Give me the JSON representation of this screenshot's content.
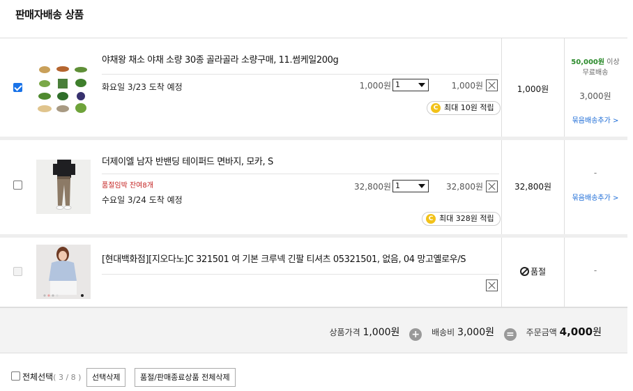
{
  "section_title": "판매자배송 상품",
  "items": [
    {
      "checked": true,
      "name": "야채왕 채소 야채 소량 30종 골라골라 소량구매, 11.썸케일200g",
      "arrival": "화요일 3/23 도착 예정",
      "unit_price": "1,000원",
      "qty": "1",
      "line_price": "1,000원",
      "points": "최대 10원 적립",
      "coin_label": "C",
      "subtotal": "1,000원",
      "shipping": {
        "free_amount": "50,000원",
        "free_suffix": " 이상",
        "free_text": "무료배송",
        "fee": "3,000원",
        "bundle": "묶음배송추가 >"
      }
    },
    {
      "checked": false,
      "name": "더제이엘 남자 반밴딩 테이퍼드 면바지, 모카, S",
      "warning": "품절임박 잔여8개",
      "arrival": "수요일 3/24 도착 예정",
      "unit_price": "32,800원",
      "qty": "1",
      "line_price": "32,800원",
      "points": "최대 328원 적립",
      "coin_label": "C",
      "subtotal": "32,800원",
      "shipping": {
        "dash": "-",
        "bundle": "묶음배송추가 >"
      }
    },
    {
      "checked": false,
      "disabled": true,
      "name": "[현대백화점][지오다노]C 321501 여 기본 크루넥 긴팔 티셔츠 05321501, 없음, 04 망고옐로우/S",
      "status": "품절",
      "shipping": {
        "dash": "-"
      }
    }
  ],
  "totals": {
    "product_label": "상품가격",
    "product_value": "1,000원",
    "plus": "+",
    "shipping_label": "배송비",
    "shipping_value": "3,000원",
    "equals": "=",
    "order_label": "주문금액",
    "order_amount": "4,000",
    "order_unit": "원"
  },
  "bottom": {
    "select_all": "전체선택",
    "count": "( 3 / 8 )",
    "delete_selected": "선택삭제",
    "delete_soldout": "품절/판매종료상품 전체삭제"
  },
  "colors": {
    "accent_blue": "#1a73e8",
    "link": "#1a6ad6",
    "warning": "#c3201f",
    "free_ship": "#2a8a2a",
    "coin": "#f2c21a"
  }
}
